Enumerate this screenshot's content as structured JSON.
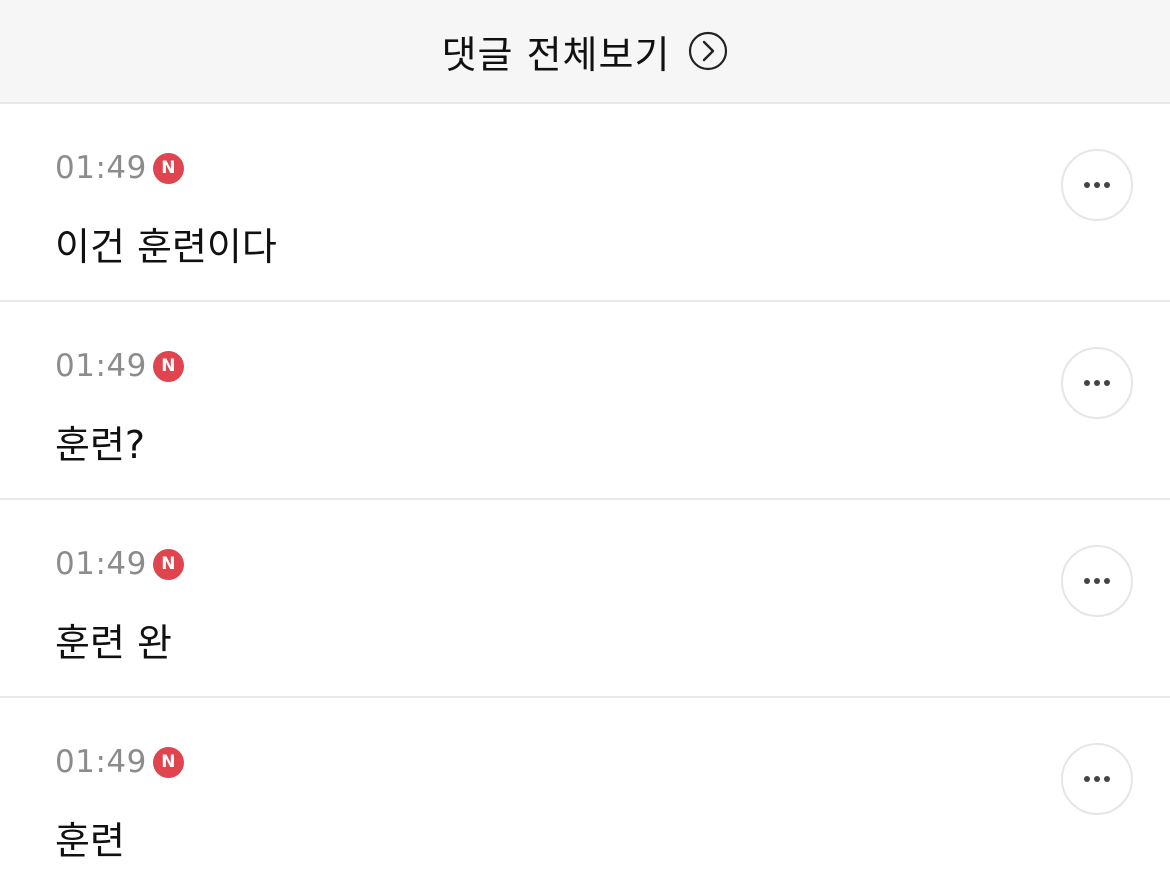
{
  "header": {
    "title": "댓글 전체보기",
    "icon": "chevron-right-circle-icon"
  },
  "badge": {
    "label": "N",
    "color": "#e0444e"
  },
  "comments": [
    {
      "time": "01:49",
      "text": "이건 훈련이다"
    },
    {
      "time": "01:49",
      "text": "훈련?"
    },
    {
      "time": "01:49",
      "text": "훈련 완"
    },
    {
      "time": "01:49",
      "text": "훈련"
    }
  ]
}
